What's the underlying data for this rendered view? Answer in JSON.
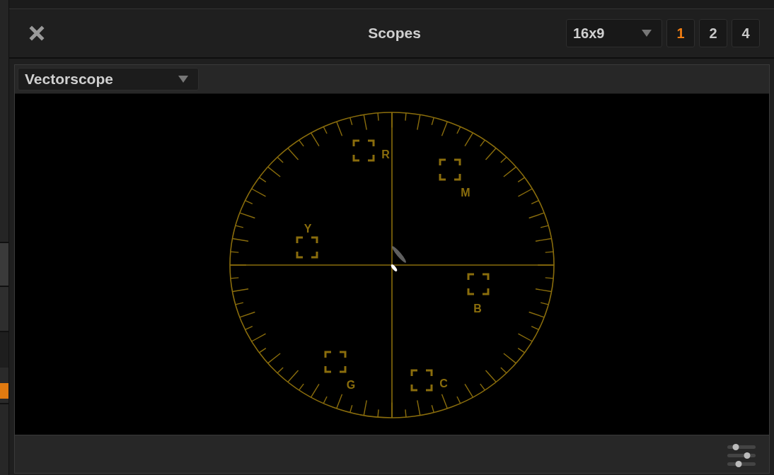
{
  "window": {
    "title": "Scopes"
  },
  "aspect_dropdown": {
    "value": "16x9"
  },
  "layout_buttons": [
    {
      "label": "1",
      "selected": true
    },
    {
      "label": "2",
      "selected": false
    },
    {
      "label": "4",
      "selected": false
    }
  ],
  "scope_dropdown": {
    "value": "Vectorscope"
  },
  "vectorscope": {
    "targets": [
      {
        "label": "R"
      },
      {
        "label": "M"
      },
      {
        "label": "Y"
      },
      {
        "label": "B"
      },
      {
        "label": "G"
      },
      {
        "label": "C"
      }
    ]
  }
}
